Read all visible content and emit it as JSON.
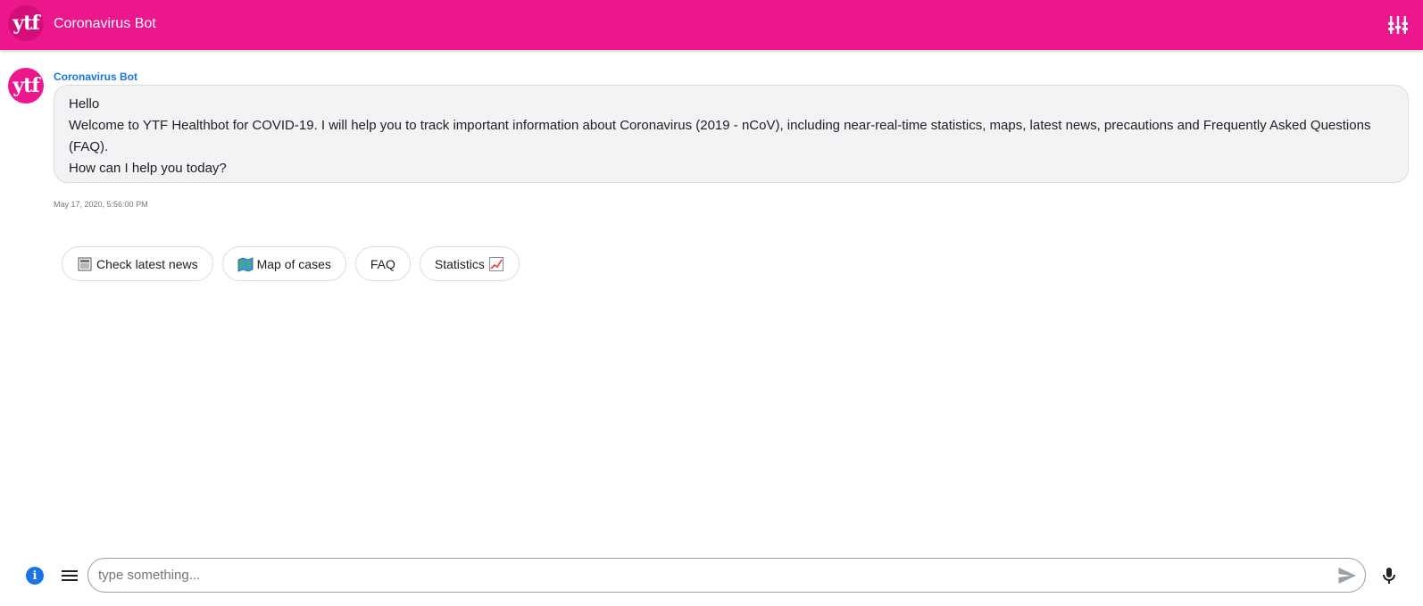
{
  "header": {
    "logo_text": "ytf",
    "title": "Coronavirus Bot",
    "menu_icon": "equalizer-icon",
    "accent_color": "#ec178c"
  },
  "message": {
    "avatar_text": "ytf",
    "sender": "Coronavirus Bot",
    "lines": [
      "Hello",
      "Welcome to YTF Healthbot for COVID-19. I will help you to track important information about Coronavirus (2019 - nCoV), including near-real-time statistics, maps, latest news, precautions and Frequently Asked Questions (FAQ).",
      "How can I help you today?"
    ],
    "timestamp": "May 17, 2020, 5:56:00 PM"
  },
  "suggestions": [
    {
      "label": "Check latest news",
      "icon": "newspaper-icon"
    },
    {
      "label": "Map of cases",
      "icon": "map-icon"
    },
    {
      "label": "FAQ",
      "icon": ""
    },
    {
      "label": "Statistics",
      "icon": "chart-increasing-icon"
    }
  ],
  "input": {
    "placeholder": "type something...",
    "value": ""
  }
}
